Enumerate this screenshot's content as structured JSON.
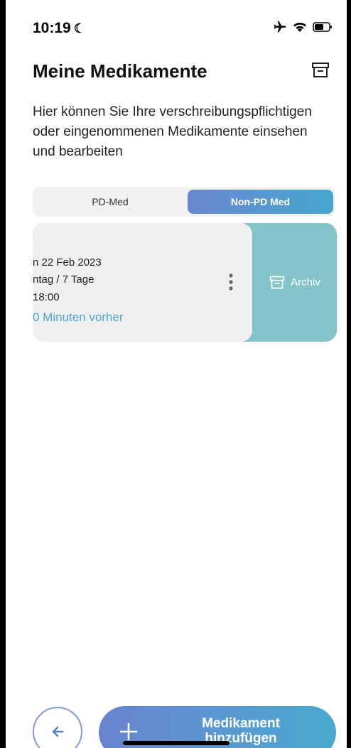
{
  "status_bar": {
    "time": "10:19"
  },
  "page": {
    "title": "Meine Medikamente",
    "description": "Hier können Sie Ihre verschreibungspflichtigen oder eingenommenen Medikamente einsehen und bearbeiten"
  },
  "tabs": [
    {
      "label": "PD-Med",
      "selected": false
    },
    {
      "label": "Non-PD Med",
      "selected": true
    }
  ],
  "medication_card": {
    "line1": "n 22 Feb 2023",
    "line2": "ntag / 7 Tage",
    "line3": "18:00",
    "line4": "0 Minuten vorher",
    "swipe_action_label": "Archiv"
  },
  "bottom": {
    "add_label_line1": "Medikament",
    "add_label_line2": "hinzufügen"
  },
  "colors": {
    "accent_start": "#6a83cf",
    "accent_end": "#4aaad0",
    "archive_bg": "#83c4cb",
    "reminder_text": "#4aa6cc"
  }
}
